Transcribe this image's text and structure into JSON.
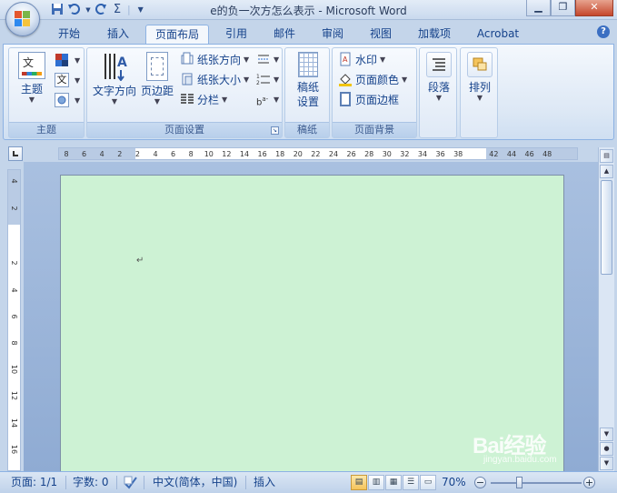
{
  "window": {
    "title": "e的负一次方怎么表示 - Microsoft Word",
    "buttons": [
      "minimize",
      "maximize",
      "close"
    ]
  },
  "quick_access": {
    "save_icon": "save-icon",
    "undo_icon": "undo-icon",
    "redo_icon": "redo-icon",
    "sigma": "Σ",
    "customize_icon": "customize-icon"
  },
  "tabs": [
    {
      "label": "开始"
    },
    {
      "label": "插入"
    },
    {
      "label": "页面布局",
      "active": true
    },
    {
      "label": "引用"
    },
    {
      "label": "邮件"
    },
    {
      "label": "审阅"
    },
    {
      "label": "视图"
    },
    {
      "label": "加载项"
    },
    {
      "label": "Acrobat"
    }
  ],
  "ribbon": {
    "theme_group": {
      "label": "主题",
      "themes_button": "主题",
      "theme_text_glyph": "文"
    },
    "page_setup_group": {
      "label": "页面设置",
      "text_direction": "文字方向",
      "margins": "页边距",
      "orientation": "纸张方向",
      "size": "纸张大小",
      "columns": "分栏"
    },
    "manuscript_group": {
      "label": "稿纸",
      "manuscript_settings_line1": "稿纸",
      "manuscript_settings_line2": "设置"
    },
    "page_background_group": {
      "label": "页面背景",
      "watermark": "水印",
      "page_color": "页面颜色",
      "page_borders": "页面边框"
    },
    "paragraph_group": {
      "label": "段落"
    },
    "arrange_group": {
      "label": "排列"
    }
  },
  "ruler": {
    "horizontal_ticks": [
      "8",
      "6",
      "4",
      "2",
      "2",
      "4",
      "6",
      "8",
      "10",
      "12",
      "14",
      "16",
      "18",
      "20",
      "22",
      "24",
      "26",
      "28",
      "30",
      "32",
      "34",
      "36",
      "38",
      "42",
      "44",
      "46",
      "48"
    ],
    "vertical_ticks": [
      "4",
      "2",
      "2",
      "4",
      "6",
      "8",
      "10",
      "12",
      "14",
      "16"
    ]
  },
  "document": {
    "page_color": "#cdf2d4",
    "paragraph_mark": "↵"
  },
  "status": {
    "page": "页面: 1/1",
    "words": "字数: 0",
    "language": "中文(简体，中国)",
    "mode": "插入",
    "zoom": "70%"
  },
  "watermark": {
    "line1": "Bai经验",
    "line2": "jingyan.baidu.com"
  }
}
